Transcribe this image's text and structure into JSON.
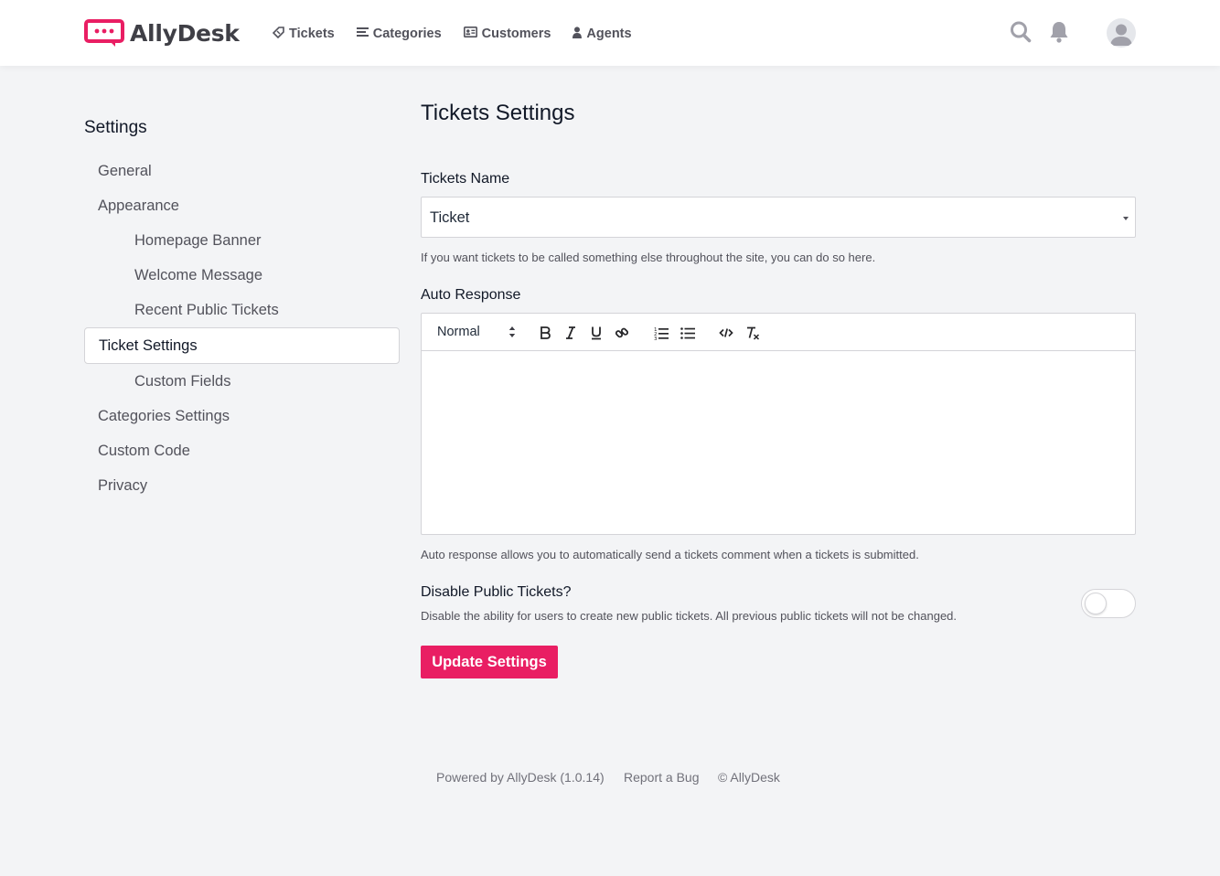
{
  "brand": {
    "name": "AllyDesk",
    "accent": "#e91e63"
  },
  "nav": [
    {
      "label": "Tickets",
      "icon": "ticket-icon"
    },
    {
      "label": "Categories",
      "icon": "list-icon"
    },
    {
      "label": "Customers",
      "icon": "id-card-icon"
    },
    {
      "label": "Agents",
      "icon": "user-icon"
    }
  ],
  "header_icons": [
    "search-icon",
    "bell-icon",
    "avatar"
  ],
  "sidebar": {
    "title": "Settings",
    "items": [
      {
        "label": "General",
        "level": 1
      },
      {
        "label": "Appearance",
        "level": 1
      },
      {
        "label": "Homepage Banner",
        "level": 2
      },
      {
        "label": "Welcome Message",
        "level": 2
      },
      {
        "label": "Recent Public Tickets",
        "level": 2
      },
      {
        "label": "Ticket Settings",
        "level": 1,
        "active": true
      },
      {
        "label": "Custom Fields",
        "level": 2
      },
      {
        "label": "Categories Settings",
        "level": 1
      },
      {
        "label": "Custom Code",
        "level": 1
      },
      {
        "label": "Privacy",
        "level": 1
      }
    ]
  },
  "main": {
    "title": "Tickets Settings",
    "tickets_name": {
      "label": "Tickets Name",
      "value": "Ticket",
      "help": "If you want tickets to be called something else throughout the site, you can do so here."
    },
    "auto_response": {
      "label": "Auto Response",
      "format": "Normal",
      "content": "",
      "toolbar": [
        "bold-icon",
        "italic-icon",
        "underline-icon",
        "link-icon",
        "ordered-list-icon",
        "bullet-list-icon",
        "code-icon",
        "clear-format-icon"
      ],
      "help": "Auto response allows you to automatically send a tickets comment when a tickets is submitted."
    },
    "disable_public": {
      "label": "Disable Public Tickets?",
      "help": "Disable the ability for users to create new public tickets. All previous public tickets will not be changed.",
      "enabled": false
    },
    "submit_label": "Update Settings"
  },
  "footer": {
    "powered": "Powered by AllyDesk (1.0.14)",
    "report": "Report a Bug",
    "copyright": "© AllyDesk"
  }
}
